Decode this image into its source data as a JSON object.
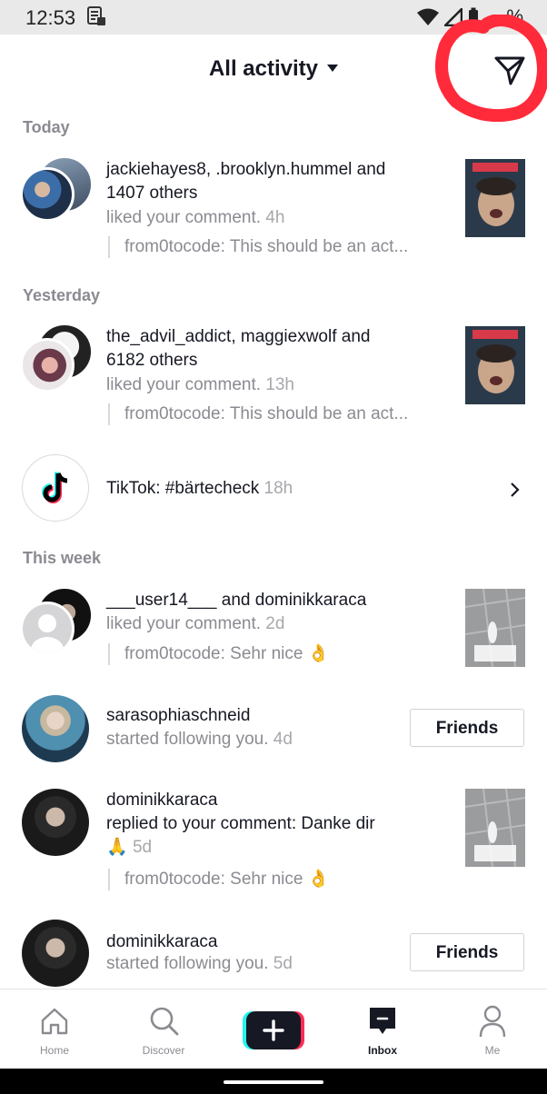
{
  "status_bar": {
    "time": "12:53",
    "battery": "%"
  },
  "header": {
    "title": "All activity"
  },
  "sections": {
    "today": "Today",
    "yesterday": "Yesterday",
    "this_week": "This week"
  },
  "activities": [
    {
      "user_a": "jackiehayes8",
      "sep": ", ",
      "user_b": ".brooklyn.hummel",
      "and": " and ",
      "others": "1407 others",
      "action": "liked your comment.",
      "ago": "4h",
      "quote": "from0tocode: This should be an act..."
    },
    {
      "user_a": "the_advil_addict",
      "sep": ", ",
      "user_b": "maggiexwolf",
      "and": " and ",
      "others": "6182 others",
      "action": "liked your comment.",
      "ago": "13h",
      "quote": "from0tocode: This should be an act..."
    },
    {
      "title": "TikTok:",
      "hashtag": "#bärtecheck",
      "ago": "18h"
    },
    {
      "user_a": "___user14___",
      "and": " and ",
      "user_b": "dominikkaraca",
      "action": "liked your comment.",
      "ago": "2d",
      "quote": "from0tocode: Sehr nice 👌"
    },
    {
      "user": "sarasophiaschneid",
      "action": "started following you.",
      "ago": "4d",
      "button": "Friends"
    },
    {
      "user": "dominikkaraca",
      "action": "replied to your comment: Danke dir",
      "emoji": "🙏",
      "ago": "5d",
      "quote": "from0tocode: Sehr nice 👌"
    },
    {
      "user": "dominikkaraca",
      "action": "started following you.",
      "ago": "5d",
      "button": "Friends"
    }
  ],
  "tabs": [
    {
      "label": "Home"
    },
    {
      "label": "Discover"
    },
    {
      "label": ""
    },
    {
      "label": "Inbox"
    },
    {
      "label": "Me"
    }
  ],
  "colors": {
    "text": "#161823",
    "muted": "#8a8b91",
    "annotation": "#ff2a3a",
    "cyan": "#25f4ee",
    "red": "#fe2c55"
  }
}
